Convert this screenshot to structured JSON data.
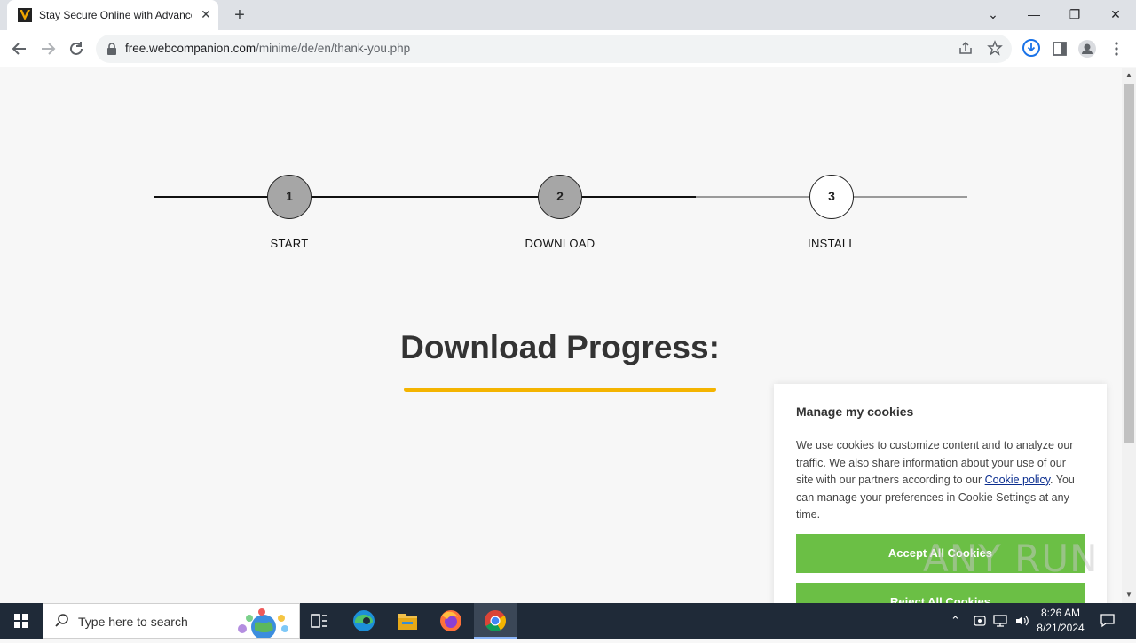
{
  "browser": {
    "tab_title": "Stay Secure Online with Advanced",
    "tab_close": "✕",
    "new_tab": "+",
    "url_domain": "free.webcompanion.com",
    "url_path": "/minime/de/en/thank-you.php",
    "window_controls": {
      "list": "⌄",
      "minimize": "—",
      "restore": "❐",
      "close": "✕"
    }
  },
  "steps": [
    {
      "number": "1",
      "label": "START"
    },
    {
      "number": "2",
      "label": "DOWNLOAD"
    },
    {
      "number": "3",
      "label": "INSTALL"
    }
  ],
  "main": {
    "heading": "Download Progress:",
    "progress_fraction": 1.0
  },
  "cookie_banner": {
    "title": "Manage my cookies",
    "text_before_link": "We use cookies to customize content and to analyze our traffic. We also share information about your use of our site with our partners according to our ",
    "link_text": "Cookie policy",
    "text_after_link": ". You can manage your preferences in Cookie Settings at any time.",
    "accept_label": "Accept All Cookies",
    "reject_label": "Reject All Cookies"
  },
  "watermark": "ANY RUN",
  "taskbar": {
    "search_placeholder": "Type here to search",
    "time": "8:26 AM",
    "date": "8/21/2024"
  },
  "colors": {
    "accent_green": "#6bbf45",
    "progress_yellow": "#f4b400",
    "step_done": "#a6a6a6"
  }
}
